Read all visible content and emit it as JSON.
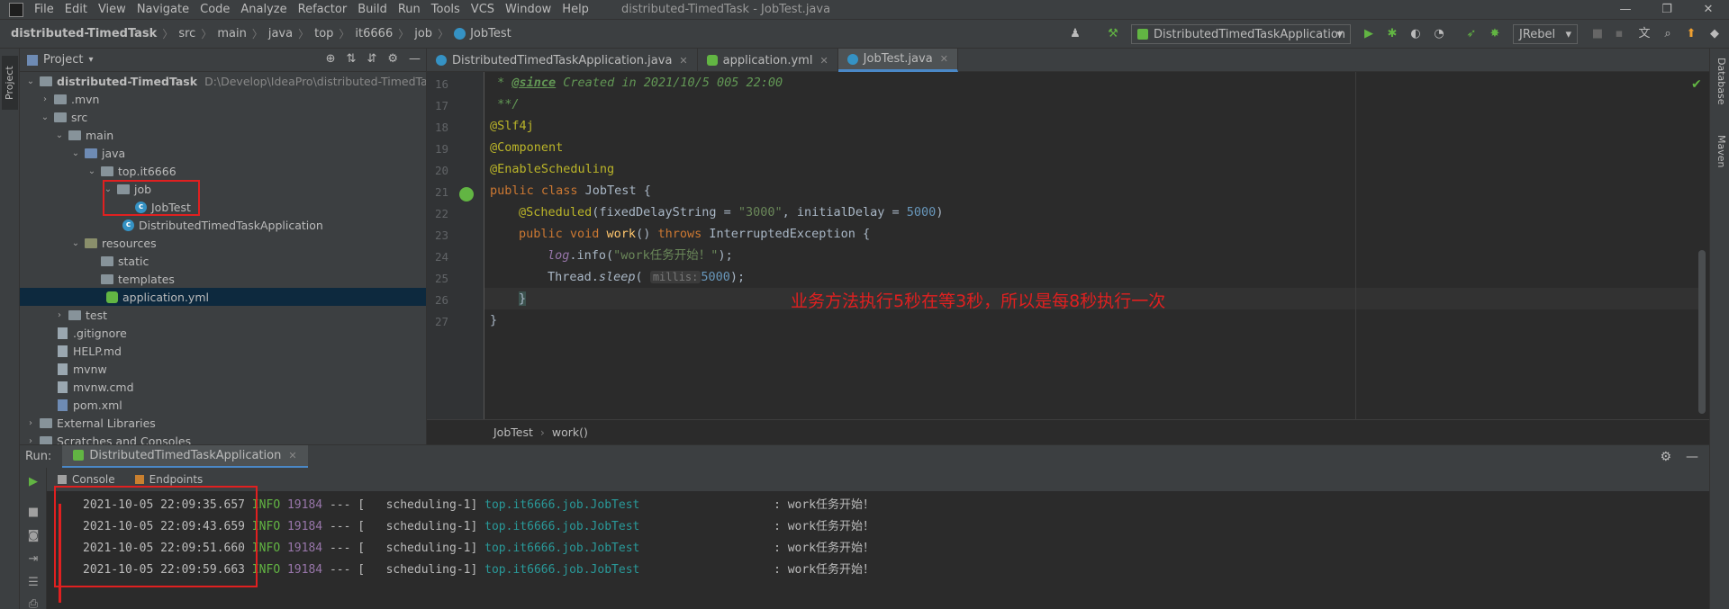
{
  "menubar": {
    "items": [
      "File",
      "Edit",
      "View",
      "Navigate",
      "Code",
      "Analyze",
      "Refactor",
      "Build",
      "Run",
      "Tools",
      "VCS",
      "Window",
      "Help"
    ],
    "window_title": "distributed-TimedTask - JobTest.java",
    "controls": [
      "—",
      "❐",
      "✕"
    ]
  },
  "navbar": {
    "crumbs": [
      "distributed-TimedTask",
      "src",
      "main",
      "java",
      "top",
      "it6666",
      "job",
      "JobTest"
    ],
    "run_config": "DistributedTimedTaskApplication",
    "jrebel": "JRebel"
  },
  "left_stripe": {
    "project_tab": "Project"
  },
  "right_stripe": {
    "database_tab": "Database",
    "maven_tab": "Maven"
  },
  "project": {
    "title": "Project",
    "tree": [
      {
        "name": "distributed-TimedTask",
        "path": "D:\\Develop\\IdeaPro\\distributed-TimedTask"
      },
      {
        "name": ".mvn"
      },
      {
        "name": "src"
      },
      {
        "name": "main"
      },
      {
        "name": "java"
      },
      {
        "name": "top.it6666"
      },
      {
        "name": "job"
      },
      {
        "name": "JobTest"
      },
      {
        "name": "DistributedTimedTaskApplication"
      },
      {
        "name": "resources"
      },
      {
        "name": "static"
      },
      {
        "name": "templates"
      },
      {
        "name": "application.yml"
      },
      {
        "name": "test"
      },
      {
        "name": ".gitignore"
      },
      {
        "name": "HELP.md"
      },
      {
        "name": "mvnw"
      },
      {
        "name": "mvnw.cmd"
      },
      {
        "name": "pom.xml"
      },
      {
        "name": "External Libraries"
      },
      {
        "name": "Scratches and Consoles"
      }
    ]
  },
  "editor": {
    "tabs": [
      {
        "label": "DistributedTimedTaskApplication.java",
        "active": false
      },
      {
        "label": "application.yml",
        "active": false
      },
      {
        "label": "JobTest.java",
        "active": true
      }
    ],
    "line_numbers": [
      "16",
      "17",
      "18",
      "19",
      "20",
      "21",
      "22",
      "23",
      "24",
      "25",
      "26",
      "27"
    ],
    "code": {
      "l16_star": " * ",
      "l16_tag": "@since",
      "l16_rest": " Created in 2021/10/5 005 22:00",
      "l17": " **/",
      "l18": "@Slf4j",
      "l19": "@Component",
      "l20": "@EnableScheduling",
      "l21_kw": "public class ",
      "l21_rest": "JobTest {",
      "l22_ann": "@Scheduled",
      "l22_a": "(fixedDelayString = ",
      "l22_str": "\"3000\"",
      "l22_b": ", initialDelay = ",
      "l22_num": "5000",
      "l22_c": ")",
      "l23_kw": "public void ",
      "l23_fn": "work",
      "l23_a": "() ",
      "l23_kw2": "throws ",
      "l23_b": "InterruptedException {",
      "l24_field": "log",
      "l24_a": ".info(",
      "l24_str": "\"work任务开始！\"",
      "l24_b": ");",
      "l25_a": "Thread.",
      "l25_static": "sleep",
      "l25_b": "( ",
      "l25_hint": "millis:",
      "l25_num": "5000",
      "l25_c": ");",
      "l26": "}",
      "l27": "}"
    },
    "annotation": "业务方法执行5秒在等3秒，所以是每8秒执行一次",
    "breadcrumb": [
      "JobTest",
      "work()"
    ]
  },
  "run": {
    "label": "Run:",
    "tab": "DistributedTimedTaskApplication",
    "subtabs": [
      "Console",
      "Endpoints"
    ],
    "logs": [
      {
        "ts": "2021-10-05 22:09:35.657",
        "level": "INFO",
        "pid": "19184",
        "dash": "---",
        "thread": "[   scheduling-1]",
        "logger": "top.it6666.job.JobTest",
        "msg": ": work任务开始！"
      },
      {
        "ts": "2021-10-05 22:09:43.659",
        "level": "INFO",
        "pid": "19184",
        "dash": "---",
        "thread": "[   scheduling-1]",
        "logger": "top.it6666.job.JobTest",
        "msg": ": work任务开始！"
      },
      {
        "ts": "2021-10-05 22:09:51.660",
        "level": "INFO",
        "pid": "19184",
        "dash": "---",
        "thread": "[   scheduling-1]",
        "logger": "top.it6666.job.JobTest",
        "msg": ": work任务开始！"
      },
      {
        "ts": "2021-10-05 22:09:59.663",
        "level": "INFO",
        "pid": "19184",
        "dash": "---",
        "thread": "[   scheduling-1]",
        "logger": "top.it6666.job.JobTest",
        "msg": ": work任务开始！"
      }
    ]
  },
  "icons": {
    "run": "play-icon",
    "debug": "bug-icon",
    "coverage": "coverage-icon",
    "profile": "profiler-icon",
    "build": "hammer-icon",
    "search": "search-icon",
    "settings": "gear-icon",
    "minimize": "minus-icon",
    "update": "update-icon",
    "translate": "translate-icon",
    "user": "user-icon"
  },
  "colors": {
    "accent": "#4a88c7",
    "annotation_red": "#e02020",
    "green": "#62b543",
    "background": "#2b2b2b",
    "panel": "#3c3f41"
  }
}
